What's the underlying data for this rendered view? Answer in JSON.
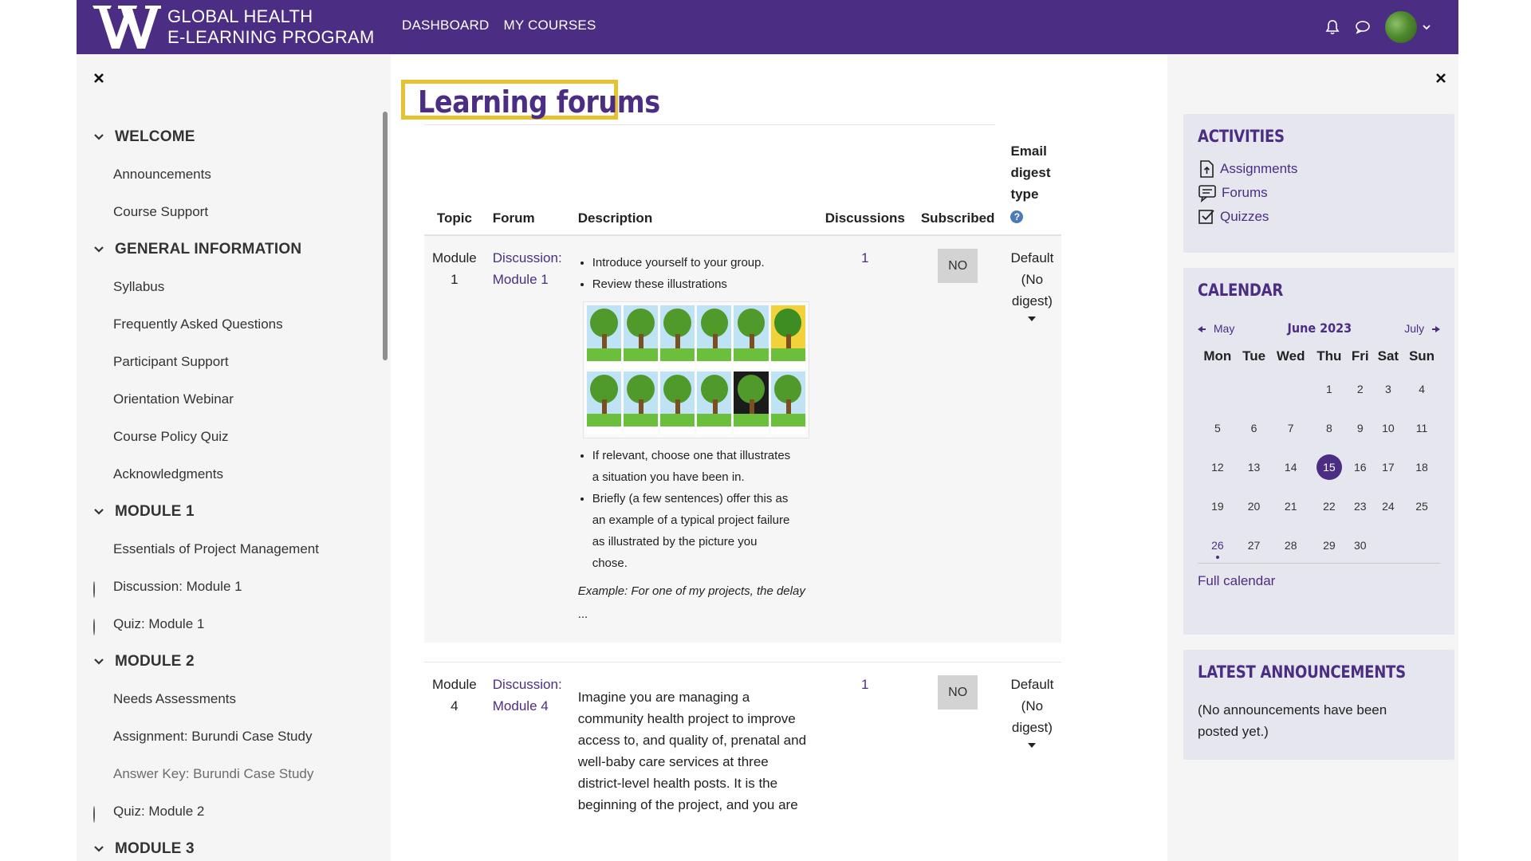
{
  "header": {
    "brand_line1": "GLOBAL HEALTH",
    "brand_line2": "E-LEARNING PROGRAM",
    "nav": [
      "DASHBOARD",
      "MY COURSES"
    ],
    "accent": "#4b2e83"
  },
  "course_index": [
    {
      "type": "section",
      "label": "WELCOME"
    },
    {
      "type": "item",
      "label": "Announcements",
      "status": "none"
    },
    {
      "type": "item",
      "label": "Course Support",
      "status": "none"
    },
    {
      "type": "section",
      "label": "GENERAL INFORMATION"
    },
    {
      "type": "item",
      "label": "Syllabus",
      "status": "done"
    },
    {
      "type": "item",
      "label": "Frequently Asked Questions",
      "status": "done"
    },
    {
      "type": "item",
      "label": "Participant Support",
      "status": "none"
    },
    {
      "type": "item",
      "label": "Orientation Webinar",
      "status": "none"
    },
    {
      "type": "item",
      "label": "Course Policy Quiz",
      "status": "done"
    },
    {
      "type": "item",
      "label": "Acknowledgments",
      "status": "none"
    },
    {
      "type": "section",
      "label": "MODULE 1"
    },
    {
      "type": "item",
      "label": "Essentials of Project Management",
      "status": "done"
    },
    {
      "type": "item",
      "label": "Discussion: Module 1",
      "status": "open"
    },
    {
      "type": "item",
      "label": "Quiz: Module 1",
      "status": "open"
    },
    {
      "type": "section",
      "label": "MODULE 2"
    },
    {
      "type": "item",
      "label": "Needs Assessments",
      "status": "done"
    },
    {
      "type": "item",
      "label": "Assignment: Burundi Case Study",
      "status": "done"
    },
    {
      "type": "item",
      "label": "Answer Key: Burundi Case Study",
      "status": "none",
      "dim": true
    },
    {
      "type": "item",
      "label": "Quiz: Module 2",
      "status": "open"
    },
    {
      "type": "section",
      "label": "MODULE 3"
    }
  ],
  "main": {
    "title": "Learning forums",
    "columns": {
      "topic": "Topic",
      "forum": "Forum",
      "description": "Description",
      "discussions": "Discussions",
      "subscribed": "Subscribed",
      "email_line1": "Email",
      "email_line2": "digest",
      "email_line3": "type"
    },
    "rows": [
      {
        "topic_line1": "Module",
        "topic_line2": "1",
        "forum_line1": "Discussion:",
        "forum_line2": "Module 1",
        "bullets1": [
          "Introduce yourself to your group.",
          "Review these illustrations"
        ],
        "bullets2_a1": "If relevant, choose one that illustrates",
        "bullets2_a2": "a situation you have been in.",
        "bullets2_b1": "Briefly (a few sentences) offer this as",
        "bullets2_b2": "an example of a typical project failure",
        "bullets2_b3": "as illustrated by the picture you",
        "bullets2_b4": "chose.",
        "example": "Example: For one of my projects, the delay",
        "ellipsis": "...",
        "discussions": "1",
        "subscribed": "NO",
        "digest_line1": "Default",
        "digest_line2": "(No",
        "digest_line3": "digest)"
      },
      {
        "topic_line1": "Module",
        "topic_line2": "4",
        "forum_line1": "Discussion:",
        "forum_line2": "Module 4",
        "desc_lines": [
          "Imagine you are managing a",
          "community health project to improve",
          "access to, and quality of, prenatal and",
          "well-baby care services at three",
          "district-level health posts. It is the",
          "beginning of the project, and you are"
        ],
        "discussions": "1",
        "subscribed": "NO",
        "digest_line1": "Default",
        "digest_line2": "(No",
        "digest_line3": "digest)"
      }
    ],
    "fab_help": "?"
  },
  "activities": {
    "title": "ACTIVITIES",
    "items": [
      "Assignments",
      "Forums",
      "Quizzes"
    ]
  },
  "calendar": {
    "title": "CALENDAR",
    "prev": "May",
    "month": "June 2023",
    "next": "July",
    "days": [
      "Mon",
      "Tue",
      "Wed",
      "Thu",
      "Fri",
      "Sat",
      "Sun"
    ],
    "weeks": [
      [
        "",
        "",
        "",
        "1",
        "2",
        "3",
        "4"
      ],
      [
        "5",
        "6",
        "7",
        "8",
        "9",
        "10",
        "11"
      ],
      [
        "12",
        "13",
        "14",
        "15",
        "16",
        "17",
        "18"
      ],
      [
        "19",
        "20",
        "21",
        "22",
        "23",
        "24",
        "25"
      ],
      [
        "26",
        "27",
        "28",
        "29",
        "30",
        "",
        ""
      ]
    ],
    "today": "15",
    "event_day": "26",
    "full_calendar": "Full calendar"
  },
  "announcements": {
    "title": "LATEST ANNOUNCEMENTS",
    "text_line1": "(No announcements have been",
    "text_line2": "posted yet.)"
  }
}
